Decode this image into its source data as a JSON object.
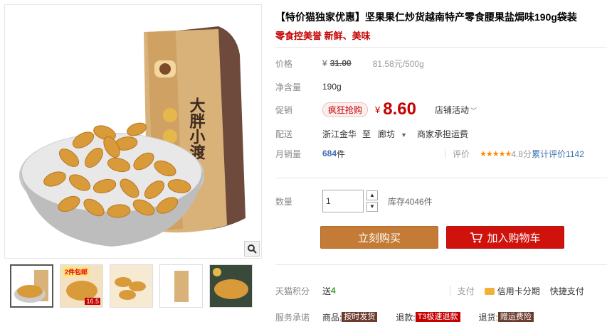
{
  "product": {
    "title": "【特价猫独家优惠】坚果果仁炒货越南特产零食腰果盐焗味190g袋装",
    "subtitle": "零食控美誉 新鲜、美味"
  },
  "gallery": {
    "zoom_icon": "magnifier-icon",
    "bag_text_1": "大胖小渡",
    "thumbnails": [
      {
        "badge": "",
        "sub": ""
      },
      {
        "badge": "2件包邮",
        "sub": "16.5"
      },
      {
        "badge": "",
        "sub": ""
      },
      {
        "badge": "",
        "sub": ""
      },
      {
        "badge": "",
        "sub": ""
      }
    ]
  },
  "price": {
    "label": "价格",
    "currency": "¥",
    "original": "31.00",
    "unit_price": "81.58元/500g"
  },
  "net_weight": {
    "label": "净含量",
    "value": "190g"
  },
  "promotion": {
    "label": "促销",
    "tag": "疯狂抢购",
    "currency": "¥",
    "price": "8.60",
    "activity": "店铺活动"
  },
  "delivery": {
    "label": "配送",
    "from": "浙江金华",
    "to_word": "至",
    "destination": "廊坊",
    "note": "商家承担运费"
  },
  "sales": {
    "label": "月销量",
    "count": "684",
    "unit": "件",
    "review_label": "评价",
    "stars": "★★★★★",
    "score": "4.8分",
    "review_text": "累计评价1142"
  },
  "quantity": {
    "label": "数量",
    "value": "1",
    "up": "▲",
    "down": "▼",
    "stock": "库存4046件"
  },
  "actions": {
    "buy_now": "立刻购买",
    "add_to_cart": "加入购物车"
  },
  "points": {
    "label": "天猫积分",
    "give": "送",
    "amount": "4",
    "pay_label": "支付",
    "credit_card": "信用卡分期",
    "fast_pay": "快捷支付"
  },
  "promise": {
    "label": "服务承诺",
    "goods_label": "商品:",
    "goods_tag": "按时发货",
    "refund_label": "退款:",
    "refund_tag": "T3极速退款",
    "return_label": "退货:",
    "return_tag": "赠运费险"
  },
  "colors": {
    "accent_red": "#c40000",
    "buy_button": "#c47b36",
    "cart_button": "#d0120d",
    "link_blue": "#3c6fb0",
    "star_orange": "#ff8a00"
  }
}
